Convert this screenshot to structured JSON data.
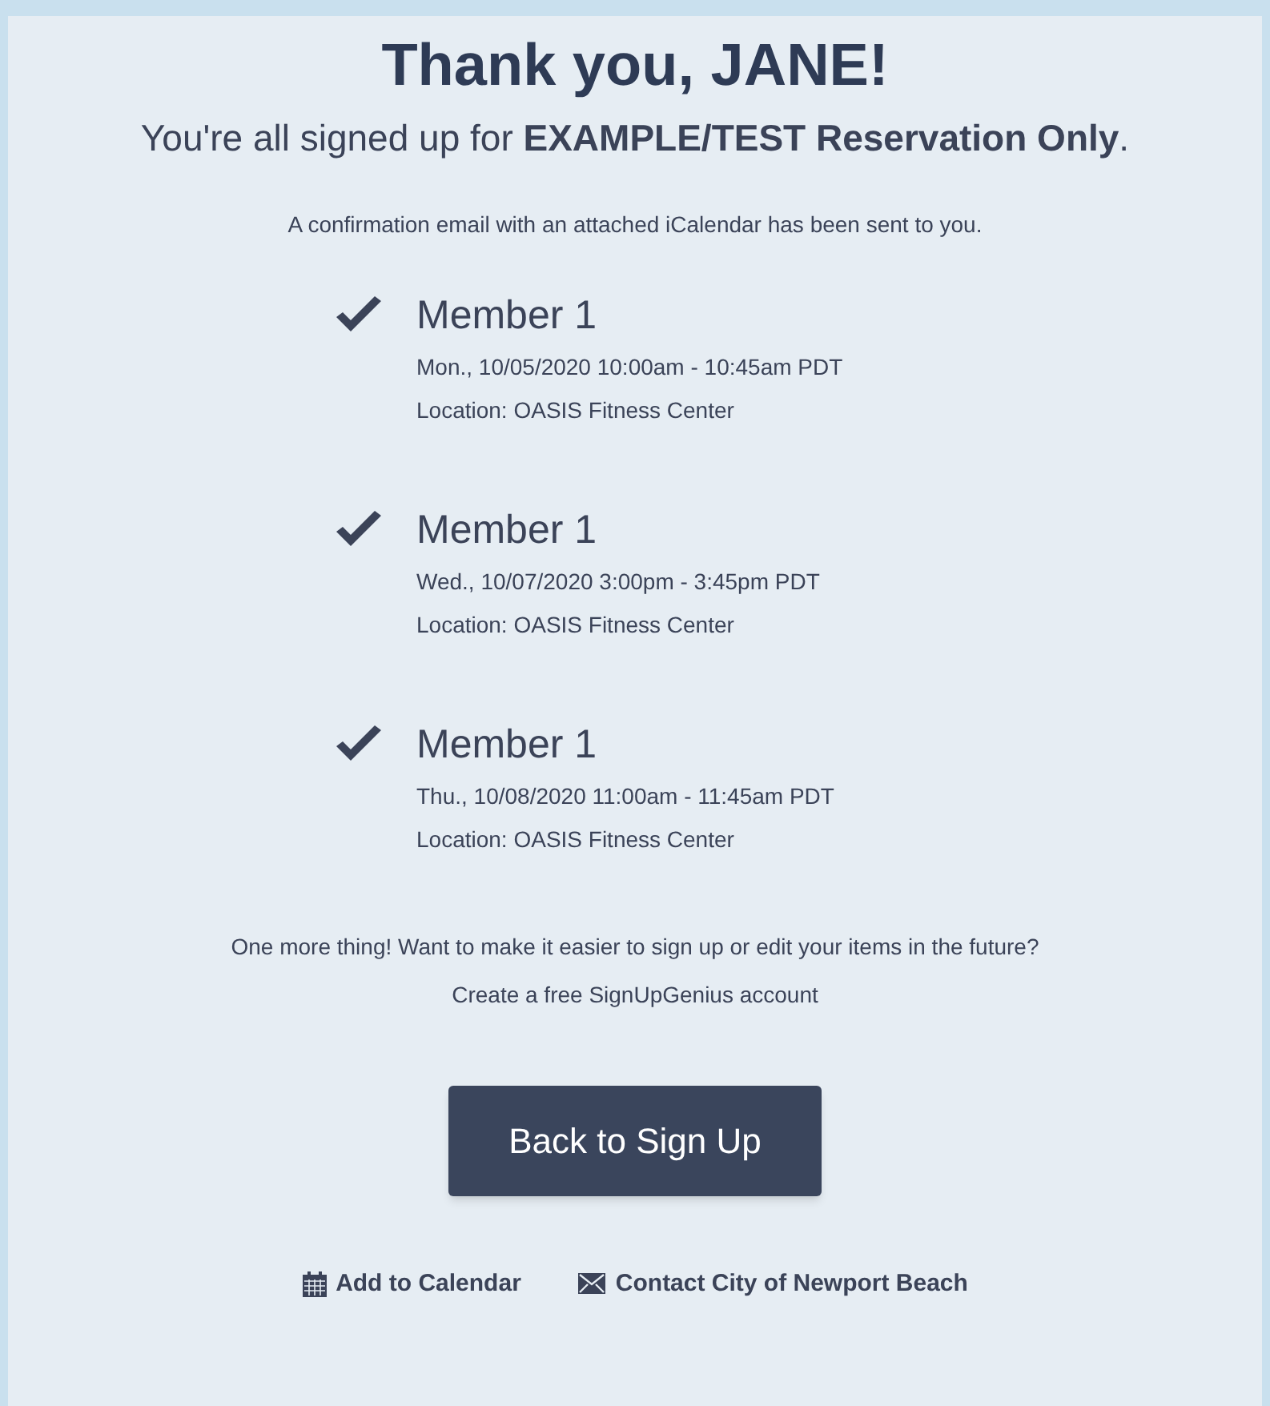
{
  "heading": "Thank you, JANE!",
  "subtitle": "You're all signed up for **EXAMPLE/TEST Reservation Only**.",
  "confirmation": "A confirmation email with an attached iCalendar has been sent to you.",
  "items": [
    {
      "checked": true,
      "title": "Member 1",
      "when": "Mon., 10/05/2020 10:00am - 10:45am PDT",
      "location": "Location: OASIS Fitness Center"
    },
    {
      "checked": true,
      "title": "Member 1",
      "when": "Wed., 10/07/2020 3:00pm - 3:45pm PDT",
      "location": "Location: OASIS Fitness Center"
    },
    {
      "checked": true,
      "title": "Member 1",
      "when": "Thu., 10/08/2020 11:00am - 11:45am PDT",
      "location": "Location: OASIS Fitness Center"
    }
  ],
  "prompt": "One more thing! Want to make it easier to sign up or edit your items in the future?",
  "account_text": "Create a free SignUpGenius account",
  "button": "Back to Sign Up",
  "links": [
    {
      "kind": "calendar",
      "label": "Add to Calendar"
    },
    {
      "kind": "mail",
      "label": "Contact City of Newport Beach"
    }
  ]
}
